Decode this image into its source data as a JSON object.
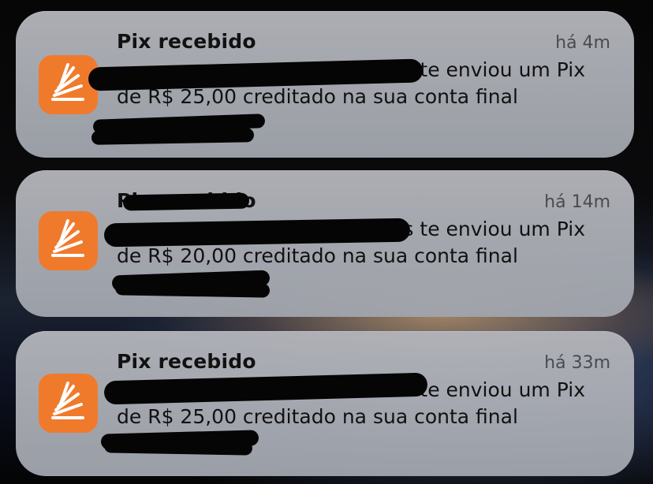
{
  "notifications": [
    {
      "title": "Pix recebido",
      "time": "há 4m",
      "line1_visible": "te enviou um Pix",
      "line2": "de R$ 25,00 creditado na sua conta final"
    },
    {
      "title": "Pix recebido",
      "time": "há 14m",
      "line1_visible": "s te enviou um Pix",
      "line2": "de R$ 20,00 creditado na sua conta final"
    },
    {
      "title": "Pix recebido",
      "time": "há 33m",
      "line1_visible": "te enviou um Pix",
      "line2": "de R$ 25,00 creditado na sua conta final"
    }
  ],
  "app_icon": {
    "name": "bank-app-icon",
    "color": "#f07a2c"
  }
}
